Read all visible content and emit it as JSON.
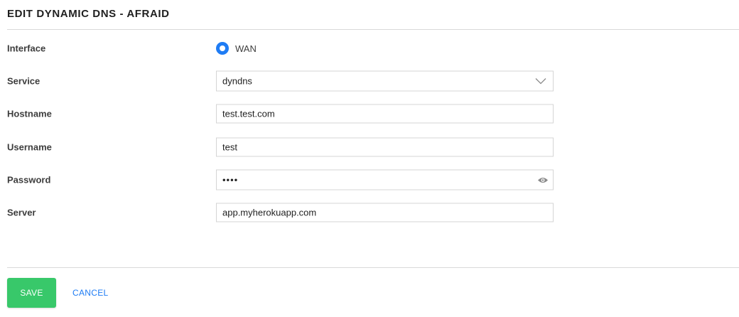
{
  "title": "EDIT DYNAMIC DNS - AFRAID",
  "form": {
    "interface": {
      "label": "Interface",
      "option": "WAN",
      "selected": true
    },
    "service": {
      "label": "Service",
      "value": "dyndns"
    },
    "hostname": {
      "label": "Hostname",
      "value": "test.test.com"
    },
    "username": {
      "label": "Username",
      "value": "test"
    },
    "password": {
      "label": "Password",
      "masked": "••••"
    },
    "server": {
      "label": "Server",
      "value": "app.myherokuapp.com"
    }
  },
  "actions": {
    "save": "SAVE",
    "cancel": "CANCEL"
  },
  "colors": {
    "accent": "#1f7cf4",
    "save": "#38c86a",
    "border": "#d4d4d4"
  },
  "icons": {
    "service_dropdown": "chevron-down-icon",
    "password_toggle": "eye-icon"
  }
}
